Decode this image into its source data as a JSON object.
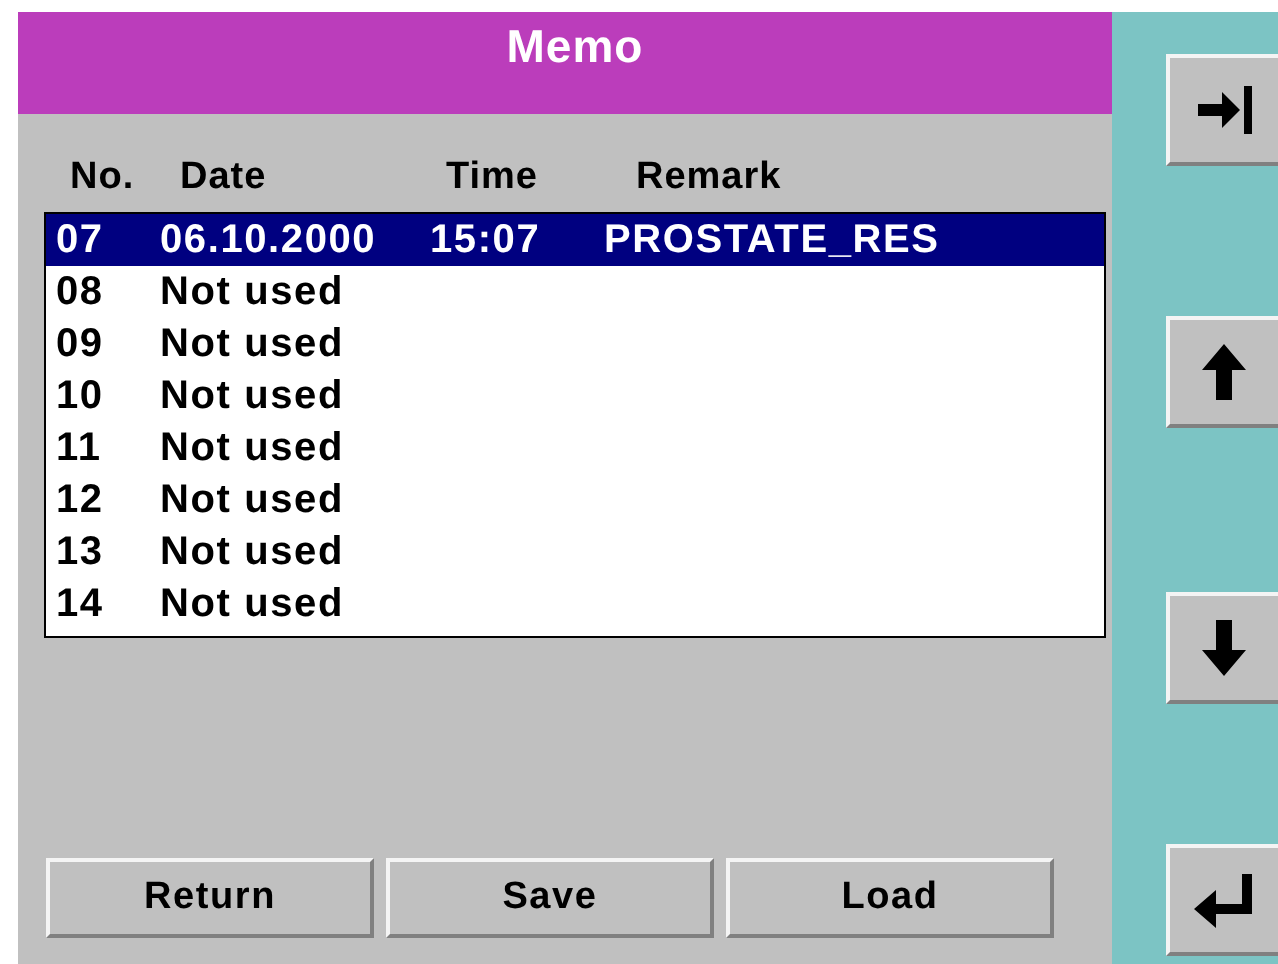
{
  "window": {
    "title": "Memo"
  },
  "columns": [
    "No.",
    "Date",
    "Time",
    "Remark"
  ],
  "rows": [
    {
      "no": "07",
      "date": "06.10.2000",
      "time": "15:07",
      "remark": "PROSTATE_RES",
      "selected": true
    },
    {
      "no": "08",
      "date": "Not used",
      "selected": false
    },
    {
      "no": "09",
      "date": "Not used",
      "selected": false
    },
    {
      "no": "10",
      "date": "Not used",
      "selected": false
    },
    {
      "no": "11",
      "date": "Not used",
      "selected": false
    },
    {
      "no": "12",
      "date": "Not used",
      "selected": false
    },
    {
      "no": "13",
      "date": "Not used",
      "selected": false
    },
    {
      "no": "14",
      "date": "Not used",
      "selected": false
    }
  ],
  "buttons": [
    "Return",
    "Save",
    "Load"
  ],
  "side_buttons": [
    {
      "kind": "tab"
    },
    {
      "kind": "up"
    },
    {
      "kind": "down"
    },
    {
      "kind": "enter"
    }
  ]
}
